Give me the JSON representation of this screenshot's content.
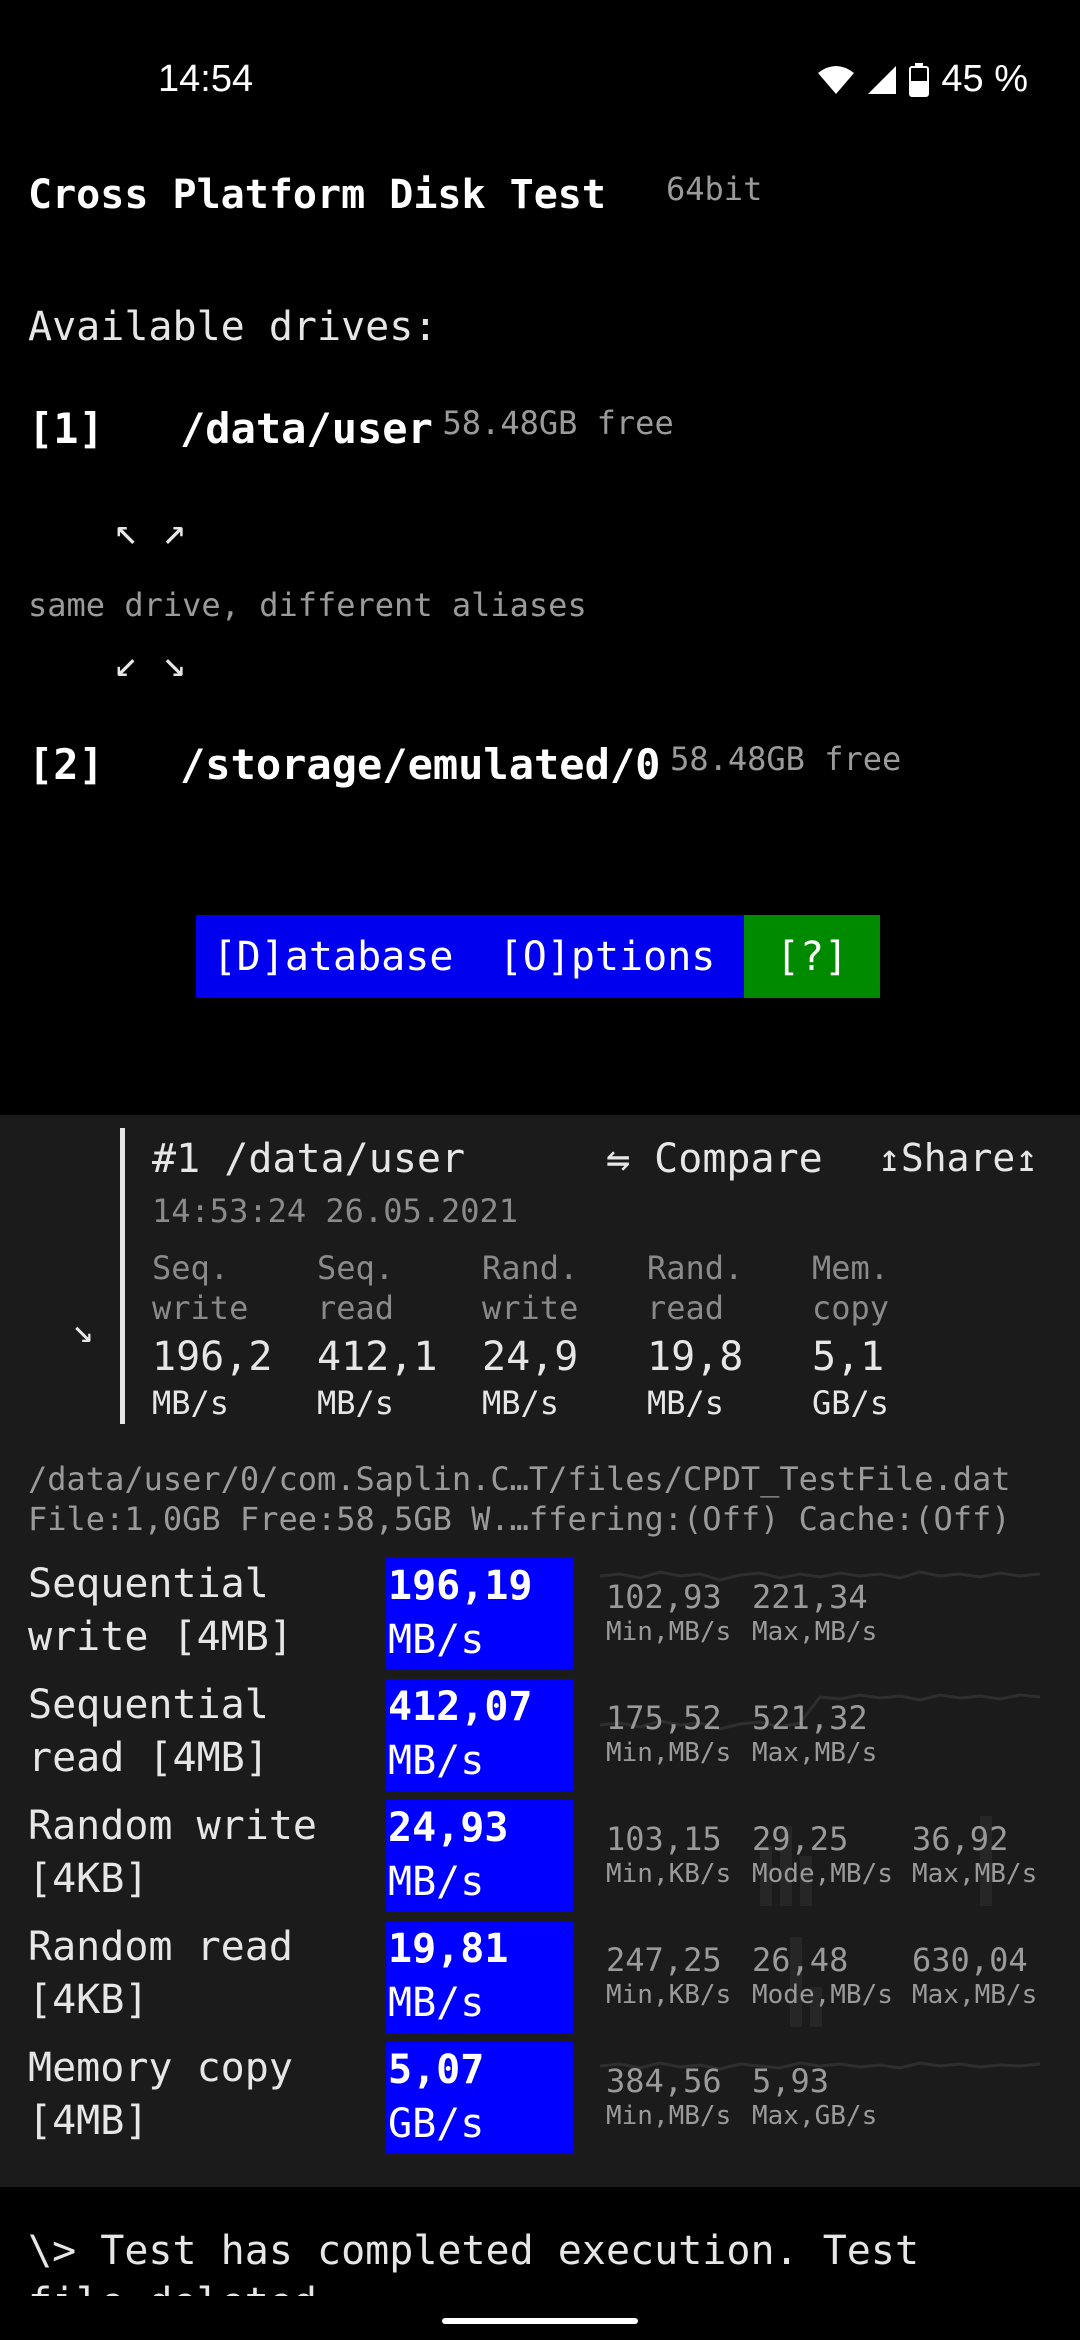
{
  "status": {
    "time": "14:54",
    "battery": "45 %"
  },
  "app": {
    "title": "Cross Platform Disk Test",
    "arch": "64bit"
  },
  "drives": {
    "heading": "Available drives:",
    "items": [
      {
        "index": "[1]",
        "path": "/data/user",
        "free": "58.48GB free"
      },
      {
        "index": "[2]",
        "path": "/storage/emulated/0",
        "free": "58.48GB free"
      }
    ],
    "arrows_up": "↖ ↗",
    "alias_note": "same drive, different aliases",
    "arrows_down": "↙ ↘"
  },
  "menu": {
    "database": "[D]atabase",
    "options": "[O]ptions",
    "help": "[?]"
  },
  "colors": {
    "menu_blue": "#0000ee",
    "help_green": "#008a00",
    "result_blue": "#0000ff",
    "panel_bg": "#1b1b1b"
  },
  "result": {
    "title": "#1 /data/user",
    "compare": "⇋ Compare",
    "share": "↥Share↥",
    "timestamp": "14:53:24 26.05.2021",
    "collapse_icon": "↘",
    "summary": [
      {
        "label": "Seq.\nwrite",
        "value": "196,2",
        "unit": "MB/s"
      },
      {
        "label": "Seq.\nread",
        "value": "412,1",
        "unit": "MB/s"
      },
      {
        "label": "Rand.\nwrite",
        "value": "24,9",
        "unit": "MB/s"
      },
      {
        "label": "Rand.\nread",
        "value": "19,8",
        "unit": "MB/s"
      },
      {
        "label": "Mem.\ncopy",
        "value": "5,1",
        "unit": "GB/s"
      }
    ],
    "file_path": "/data/user/0/com.Saplin.C…T/files/CPDT_TestFile.dat",
    "file_info": "File:1,0GB Free:58,5GB W.…ffering:(Off) Cache:(Off)",
    "tests": [
      {
        "name": "Sequential\nwrite [4MB]",
        "value": "196,19",
        "unit": "MB/s",
        "stats": [
          {
            "v": "102,93",
            "l": "Min,MB/s"
          },
          {
            "v": "221,34",
            "l": "Max,MB/s"
          }
        ]
      },
      {
        "name": "Sequential\nread [4MB]",
        "value": "412,07",
        "unit": "MB/s",
        "stats": [
          {
            "v": "175,52",
            "l": "Min,MB/s"
          },
          {
            "v": "521,32",
            "l": "Max,MB/s"
          }
        ]
      },
      {
        "name": "Random write\n[4KB]",
        "value": "24,93",
        "unit": "MB/s",
        "stats": [
          {
            "v": "103,15",
            "l": "Min,KB/s"
          },
          {
            "v": "29,25",
            "l": "Mode,MB/s"
          },
          {
            "v": "36,92",
            "l": "Max,MB/s"
          }
        ]
      },
      {
        "name": "Random read\n[4KB]",
        "value": "19,81",
        "unit": "MB/s",
        "stats": [
          {
            "v": "247,25",
            "l": "Min,KB/s"
          },
          {
            "v": "26,48",
            "l": "Mode,MB/s"
          },
          {
            "v": "630,04",
            "l": "Max,MB/s"
          }
        ]
      },
      {
        "name": "Memory copy\n[4MB]",
        "value": "5,07",
        "unit": "GB/s",
        "stats": [
          {
            "v": "384,56",
            "l": "Min,MB/s"
          },
          {
            "v": "5,93",
            "l": "Max,GB/s"
          }
        ]
      }
    ]
  },
  "console": {
    "line1": "\\> Test has completed execution. Test",
    "line2": "file deleted."
  }
}
